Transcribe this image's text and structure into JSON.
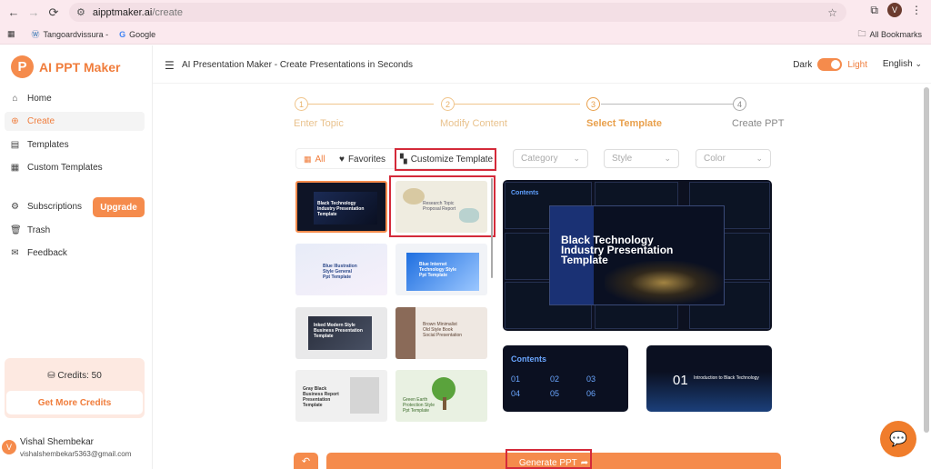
{
  "browser": {
    "url_host": "aipptmaker.ai",
    "url_path": "/create",
    "profile_initial": "V",
    "bookmarks": [
      "Tangoardvissura -",
      "Google"
    ],
    "all_bookmarks": "All Bookmarks"
  },
  "app": {
    "logo_letter": "P",
    "logo_text": "AI PPT Maker",
    "header_title": "AI Presentation Maker - Create Presentations in Seconds",
    "theme_dark": "Dark",
    "theme_light": "Light",
    "language": "English",
    "accent_color": "#f58b4c"
  },
  "sidebar": {
    "items": [
      {
        "label": "Home",
        "icon": "home-icon"
      },
      {
        "label": "Create",
        "icon": "plus-circle-icon"
      },
      {
        "label": "Templates",
        "icon": "templates-icon"
      },
      {
        "label": "Custom Templates",
        "icon": "custom-templates-icon"
      },
      {
        "label": "Subscriptions",
        "icon": "subscriptions-icon"
      },
      {
        "label": "Trash",
        "icon": "trash-icon"
      },
      {
        "label": "Feedback",
        "icon": "feedback-icon"
      }
    ],
    "upgrade_label": "Upgrade",
    "credits_label": "Credits: 50",
    "more_credits_label": "Get More Credits",
    "user_initial": "V",
    "user_name": "Vishal Shembekar",
    "user_email": "vishalshembekar5363@gmail.com"
  },
  "steps": [
    {
      "num": "1",
      "label": "Enter Topic"
    },
    {
      "num": "2",
      "label": "Modify Content"
    },
    {
      "num": "3",
      "label": "Select Template"
    },
    {
      "num": "4",
      "label": "Create PPT"
    }
  ],
  "filters": {
    "tab_all": "All",
    "tab_favorites": "Favorites",
    "tab_customize": "Customize Template",
    "category_placeholder": "Category",
    "style_placeholder": "Style",
    "color_placeholder": "Color"
  },
  "thumbnails": [
    {
      "title": "Black Technology Industry Presentation Template"
    },
    {
      "title": "Research Topic Proposal Report"
    },
    {
      "title": "Blue Illustration Style General Ppt Template"
    },
    {
      "title": "Blue Internet Technology Style Ppt Template"
    },
    {
      "title": "Inked Modern Style Business Presentation Template"
    },
    {
      "title": "Brown Minimalist Old Style Book Social Presentation"
    },
    {
      "title": "Gray Black Business Report Presentation Template"
    },
    {
      "title": "Green Earth Protection Style Ppt Template"
    }
  ],
  "preview": {
    "main_title": "Black Technology Industry Presentation Template",
    "contents_title": "Contents",
    "contents_items": [
      "01",
      "02",
      "03",
      "04",
      "05",
      "06"
    ],
    "intro_num": "01",
    "intro_text": "Introduction to Black Technology"
  },
  "actions": {
    "generate_label": "Generate PPT"
  }
}
